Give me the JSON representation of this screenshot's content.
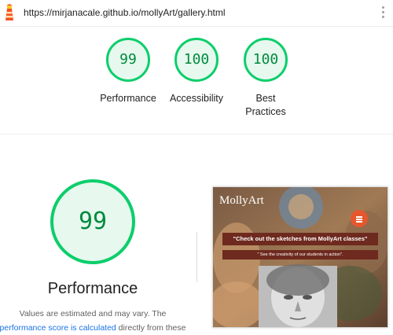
{
  "address_bar": {
    "url": "https://mirjanacale.github.io/mollyArt/gallery.html"
  },
  "summary_scores": [
    {
      "score": "99",
      "label": "Performance"
    },
    {
      "score": "100",
      "label": "Accessibility"
    },
    {
      "score": "100",
      "label_line1": "Best",
      "label_line2": "Practices"
    }
  ],
  "performance": {
    "score": "99",
    "title": "Performance",
    "desc_1": "Values are estimated and may vary. The",
    "desc_link": "performance score is calculated",
    "desc_2": " directly from these"
  },
  "screenshot": {
    "logo": "MollyArt",
    "banner_main": "\"Check out the sketches from MollyArt classes\"",
    "banner_sub": "\" See the creativity of our students in action\"."
  },
  "colors": {
    "pass_green": "#0cce6b",
    "pass_green_text": "#008a3e",
    "pass_bg": "#e7f8ee",
    "link_blue": "#1a73e8"
  },
  "icons": [
    "lighthouse-icon",
    "more-vert-icon",
    "hamburger-menu-icon"
  ]
}
